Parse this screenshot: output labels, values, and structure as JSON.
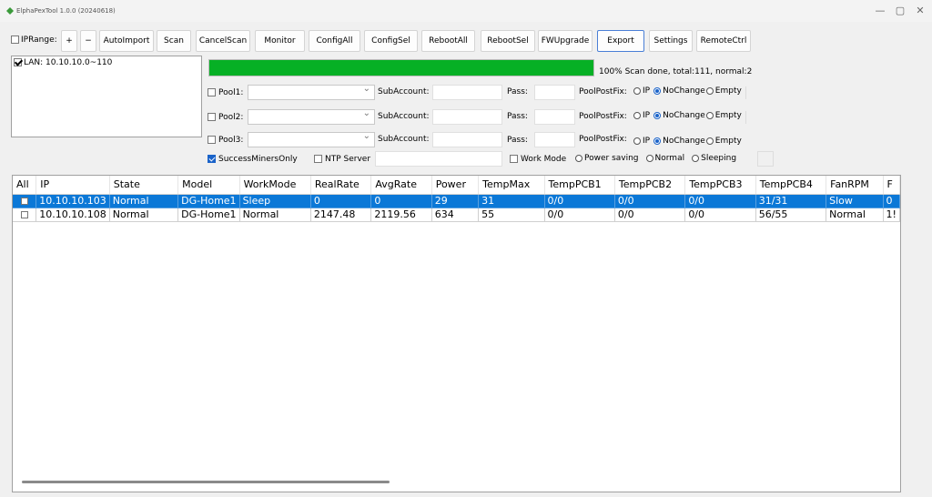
{
  "window": {
    "title": "ElphaPexTool 1.0.0 (20240618)",
    "min": "—",
    "max": "▢",
    "close": "✕"
  },
  "toolbar": {
    "iprange_label": "IPRange:",
    "plus": "+",
    "minus": "−",
    "autoimport": "AutoImport",
    "scan": "Scan",
    "cancelscan": "CancelScan",
    "monitor": "Monitor",
    "configall": "ConfigAll",
    "configsel": "ConfigSel",
    "rebootall": "RebootAll",
    "rebootsel": "RebootSel",
    "fwupgrade": "FWUpgrade",
    "export": "Export",
    "settings": "Settings",
    "remotectrl": "RemoteCtrl"
  },
  "lan": {
    "item": "LAN: 10.10.10.0~110",
    "checked": true
  },
  "progress": {
    "percent": 100,
    "status": "100% Scan done, total:111, normal:2"
  },
  "pools": [
    {
      "label": "Pool1:",
      "subaccount": "SubAccount:",
      "pass": "Pass:",
      "postfix": "PoolPostFix:",
      "opt_ip": "IP",
      "opt_nochange": "NoChange",
      "opt_empty": "Empty"
    },
    {
      "label": "Pool2:",
      "subaccount": "SubAccount:",
      "pass": "Pass:",
      "postfix": "PoolPostFix:",
      "opt_ip": "IP",
      "opt_nochange": "NoChange",
      "opt_empty": "Empty"
    },
    {
      "label": "Pool3:",
      "subaccount": "SubAccount:",
      "pass": "Pass:",
      "postfix": "PoolPostFix:",
      "opt_ip": "IP",
      "opt_nochange": "NoChange",
      "opt_empty": "Empty"
    }
  ],
  "options": {
    "success_only": "SuccessMinersOnly",
    "ntp_server": "NTP Server",
    "work_mode": "Work Mode",
    "power_saving": "Power saving",
    "normal": "Normal",
    "sleeping": "Sleeping"
  },
  "table": {
    "headers": [
      "All",
      "IP",
      "State",
      "Model",
      "WorkMode",
      "RealRate",
      "AvgRate",
      "Power",
      "TempMax",
      "TempPCB1",
      "TempPCB2",
      "TempPCB3",
      "TempPCB4",
      "FanRPM",
      "F"
    ],
    "rows": [
      [
        "",
        "10.10.10.103",
        "Normal",
        "DG-Home1",
        "Sleep",
        "0",
        "0",
        "29",
        "31",
        "0/0",
        "0/0",
        "0/0",
        "31/31",
        "Slow",
        "0"
      ],
      [
        "",
        "10.10.10.108",
        "Normal",
        "DG-Home1",
        "Normal",
        "2147.48",
        "2119.56",
        "634",
        "55",
        "0/0",
        "0/0",
        "0/0",
        "56/55",
        "Normal",
        "1!"
      ]
    ],
    "selected_row": 0
  },
  "colors": {
    "progress": "#06b025",
    "selection": "#0b78d7",
    "accent": "#1a63c9"
  }
}
